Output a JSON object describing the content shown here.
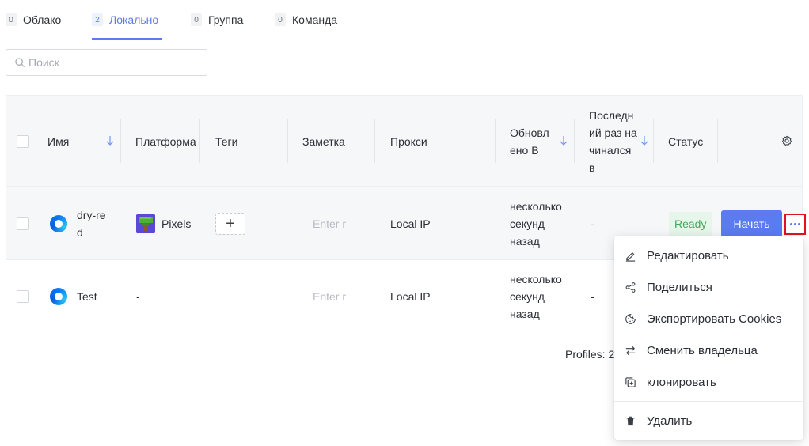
{
  "tabs": [
    {
      "count": "0",
      "label": "Облако"
    },
    {
      "count": "2",
      "label": "Локально"
    },
    {
      "count": "0",
      "label": "Группа"
    },
    {
      "count": "0",
      "label": "Команда"
    }
  ],
  "active_tab": "Локально",
  "search": {
    "placeholder": "Поиск",
    "value": ""
  },
  "table": {
    "columns": {
      "name": "Имя",
      "platform": "Платформа",
      "tags": "Теги",
      "note": "Заметка",
      "proxy": "Прокси",
      "updated": "Обновлено В",
      "last_started": "Последний раз начинался в",
      "status": "Статус"
    },
    "rows": [
      {
        "name": "dry-red",
        "platform": "Pixels",
        "tag_button": "+",
        "note_placeholder": "Enter r",
        "proxy": "Local IP",
        "updated": "несколько секунд назад",
        "last_started": "-",
        "status": "Ready",
        "start_label": "Начать"
      },
      {
        "name": "Test",
        "platform": "-",
        "note_placeholder": "Enter r",
        "proxy": "Local IP",
        "updated": "несколько секунд назад",
        "last_started": "-"
      }
    ]
  },
  "footer": {
    "profiles_text": "Profiles: 2"
  },
  "context_menu": {
    "items": [
      {
        "label": "Редактировать",
        "icon": "edit-icon"
      },
      {
        "label": "Поделиться",
        "icon": "share-icon"
      },
      {
        "label": "Экспортировать Cookies",
        "icon": "cookie-icon"
      },
      {
        "label": "Сменить владельца",
        "icon": "swap-icon"
      },
      {
        "label": "клонировать",
        "icon": "clone-icon"
      },
      {
        "label": "Удалить",
        "icon": "trash-icon"
      }
    ]
  },
  "colors": {
    "accent": "#5b7cf0",
    "ready": "#45a85d",
    "highlight": "#e0141e"
  }
}
